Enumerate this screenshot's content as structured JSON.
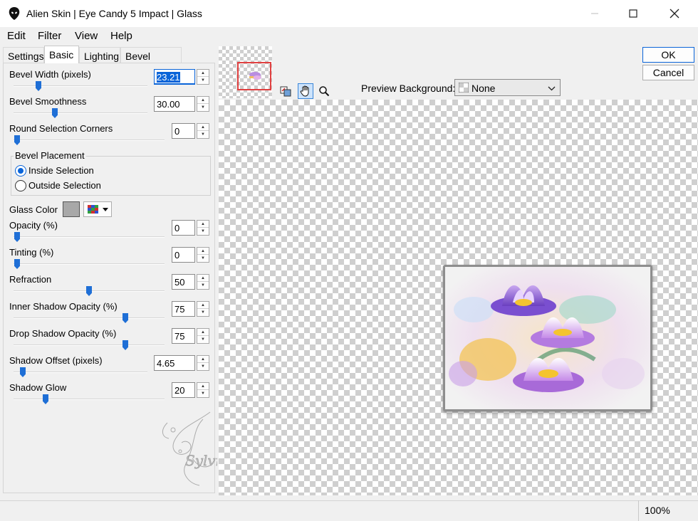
{
  "window": {
    "title": "Alien Skin | Eye Candy 5 Impact | Glass"
  },
  "menu": {
    "items": [
      {
        "label": "Edit"
      },
      {
        "label": "Filter"
      },
      {
        "label": "View"
      },
      {
        "label": "Help"
      }
    ]
  },
  "tabs": [
    {
      "label": "Settings",
      "active": false
    },
    {
      "label": "Basic",
      "active": true
    },
    {
      "label": "Lighting",
      "active": false
    },
    {
      "label": "Bevel Profile",
      "active": false
    }
  ],
  "params": {
    "bevel_width": {
      "label": "Bevel Width (pixels)",
      "value": "23.21",
      "slider_fraction": 0.19
    },
    "bevel_smoothness": {
      "label": "Bevel Smoothness",
      "value": "30.00",
      "slider_fraction": 0.3
    },
    "round_corners": {
      "label": "Round Selection Corners",
      "value": "0",
      "slider_fraction": 0.0
    },
    "opacity": {
      "label": "Opacity (%)",
      "value": "0",
      "slider_fraction": 0.0
    },
    "tinting": {
      "label": "Tinting (%)",
      "value": "0",
      "slider_fraction": 0.0
    },
    "refraction": {
      "label": "Refraction",
      "value": "50",
      "slider_fraction": 0.5
    },
    "inner_shadow": {
      "label": "Inner Shadow Opacity (%)",
      "value": "75",
      "slider_fraction": 0.75
    },
    "drop_shadow": {
      "label": "Drop Shadow Opacity (%)",
      "value": "75",
      "slider_fraction": 0.75
    },
    "shadow_offset": {
      "label": "Shadow Offset (pixels)",
      "value": "4.65",
      "slider_fraction": 0.07
    },
    "shadow_glow": {
      "label": "Shadow Glow",
      "value": "20",
      "slider_fraction": 0.2
    }
  },
  "placement": {
    "title": "Bevel Placement",
    "inside_label": "Inside Selection",
    "outside_label": "Outside Selection",
    "selected": "inside"
  },
  "glass_color": {
    "label": "Glass Color",
    "color": "#a8a8a8"
  },
  "preview": {
    "background_label": "Preview Background:",
    "background_value": "None"
  },
  "buttons": {
    "ok": "OK",
    "cancel": "Cancel"
  },
  "status": {
    "zoom": "100%"
  },
  "watermark": {
    "text": "Sylviane"
  },
  "colors": {
    "accent": "#0a64d8",
    "slider_thumb": "#1f6fd6",
    "nav_rect": "#e04040"
  }
}
